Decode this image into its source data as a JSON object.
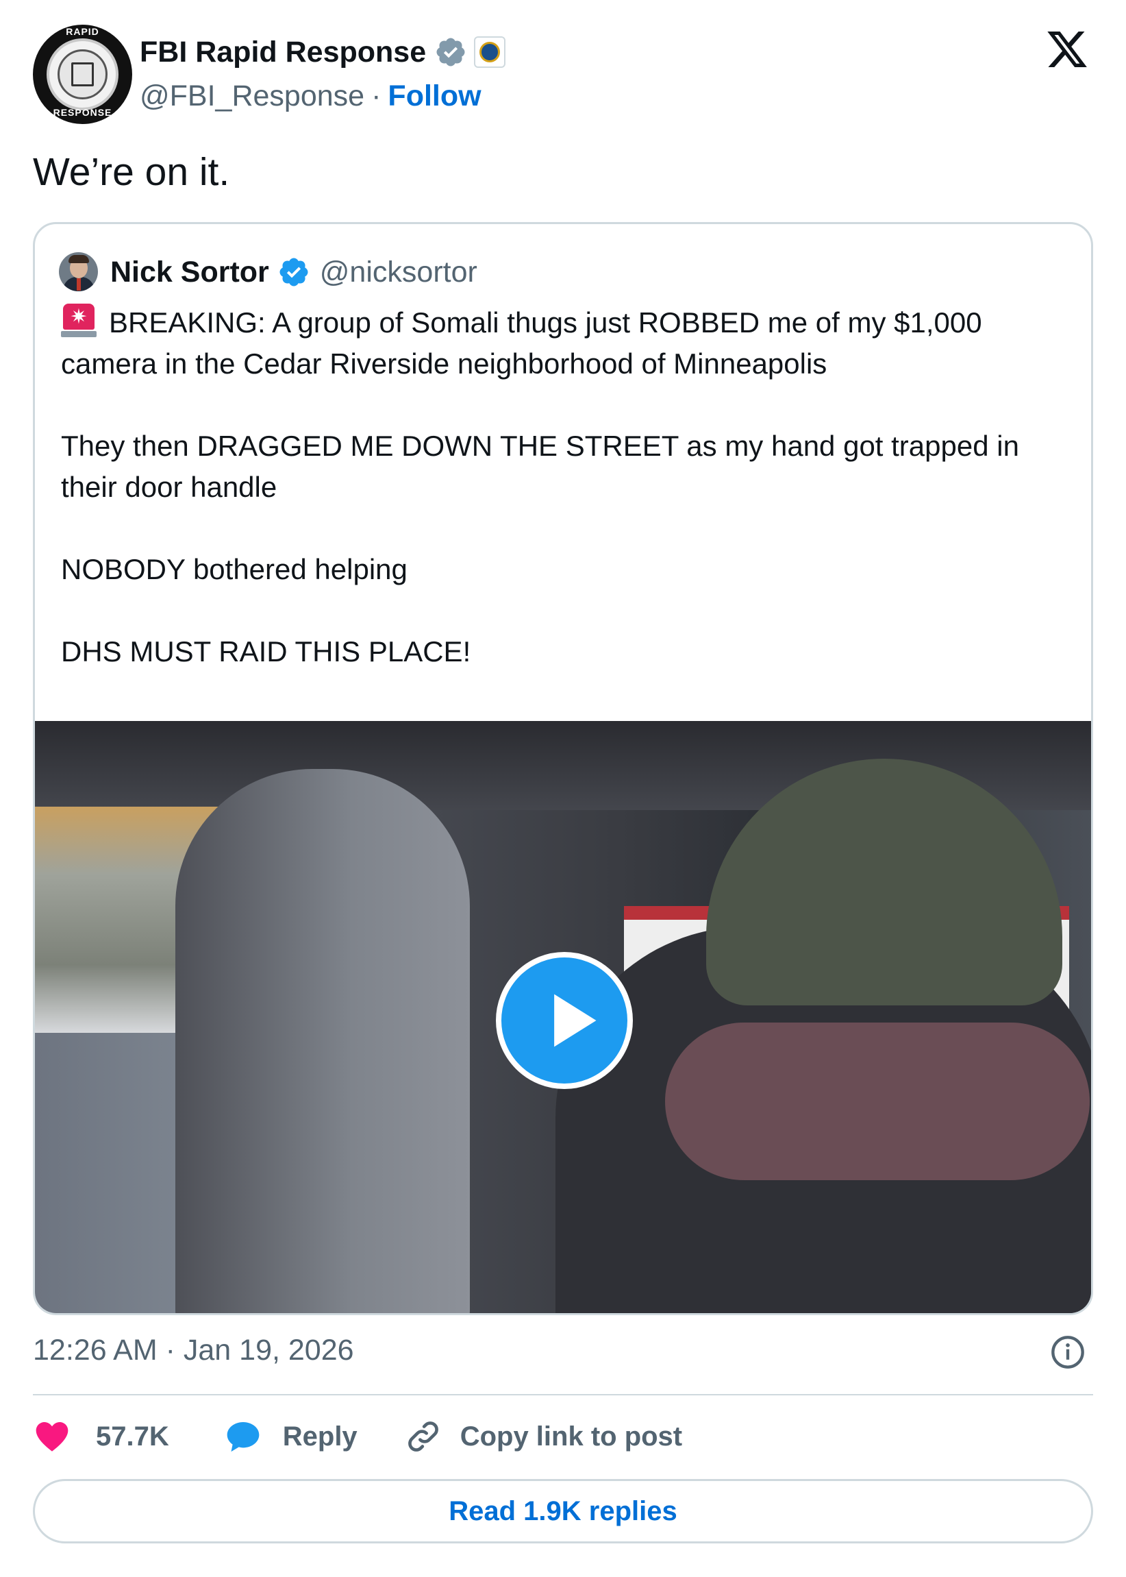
{
  "author": {
    "display_name": "FBI Rapid Response",
    "handle": "@FBI_Response",
    "separator": "·",
    "follow_label": "Follow",
    "avatar_text_top": "RAPID",
    "avatar_text_bottom": "RESPONSE"
  },
  "post": {
    "text": "We’re on it."
  },
  "quoted": {
    "display_name": "Nick Sortor",
    "handle": "@nicksortor",
    "lines": [
      "BREAKING: A group of Somali thugs just ROBBED me of my $1,000",
      "camera in the Cedar Riverside neighborhood of Minneapolis",
      "They then DRAGGED ME DOWN THE STREET as my hand got trapped in",
      "their door handle",
      "NOBODY bothered helping",
      "DHS MUST RAID THIS PLACE!"
    ],
    "leading_emoji": "siren-icon"
  },
  "meta": {
    "timestamp": "12:26 AM · Jan 19, 2026"
  },
  "actions": {
    "like_count": "57.7K",
    "reply_label": "Reply",
    "copy_label": "Copy link to post",
    "read_replies_label": "Read 1.9K replies"
  },
  "colors": {
    "link_blue": "#006fd6",
    "verified_blue": "#1d9bf0",
    "like_pink": "#f91880",
    "muted": "#536471",
    "border": "#cfd9de"
  }
}
